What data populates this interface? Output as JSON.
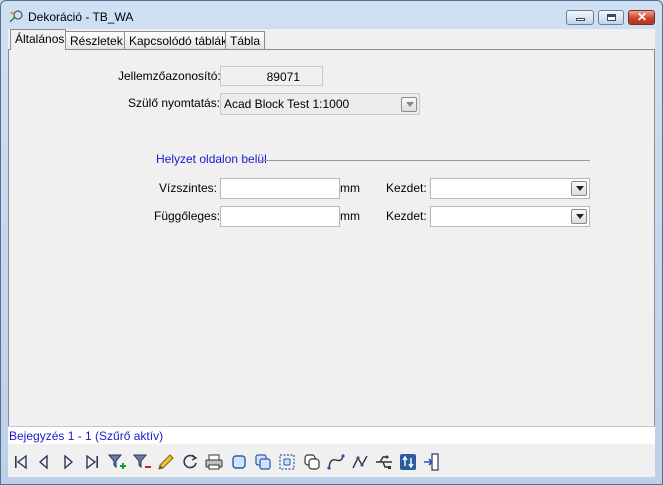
{
  "window": {
    "title": "Dekoráció - TB_WA"
  },
  "tabs": [
    {
      "label": "Általános",
      "active": true
    },
    {
      "label": "Részletek",
      "active": false
    },
    {
      "label": "Kapcsolódó táblák",
      "active": false
    },
    {
      "label": "Tábla",
      "active": false
    }
  ],
  "form": {
    "id_label": "Jellemzőazonosító:",
    "id_value": "89071",
    "parent_label": "Szülő nyomtatás:",
    "parent_value": "Acad Block Test 1:1000",
    "group_title": "Helyzet oldalon belül",
    "horizontal_label": "Vízszintes:",
    "horizontal_value": "",
    "horizontal_unit": "mm",
    "start_label_1": "Kezdet:",
    "start_value_1": "",
    "vertical_label": "Függőleges:",
    "vertical_value": "",
    "vertical_unit": "mm",
    "start_label_2": "Kezdet:",
    "start_value_2": ""
  },
  "status": {
    "text": "Bejegyzés 1 - 1 (Szűrő aktív)"
  },
  "toolbar": {
    "buttons": [
      "first-record-icon",
      "previous-record-icon",
      "next-record-icon",
      "last-record-icon",
      "filter-add-icon",
      "filter-remove-icon",
      "edit-pencil-icon",
      "refresh-icon",
      "print-icon",
      "select-object-icon",
      "select-multiple-icon",
      "select-area-icon",
      "copy-object-icon",
      "route-icon",
      "connect-icon",
      "usb-network-icon",
      "sort-updown-icon",
      "exit-icon"
    ]
  },
  "colors": {
    "accent_text": "#1a1ad2",
    "panel": "#f0f0f0",
    "window_frame": "#bcd0ea"
  }
}
